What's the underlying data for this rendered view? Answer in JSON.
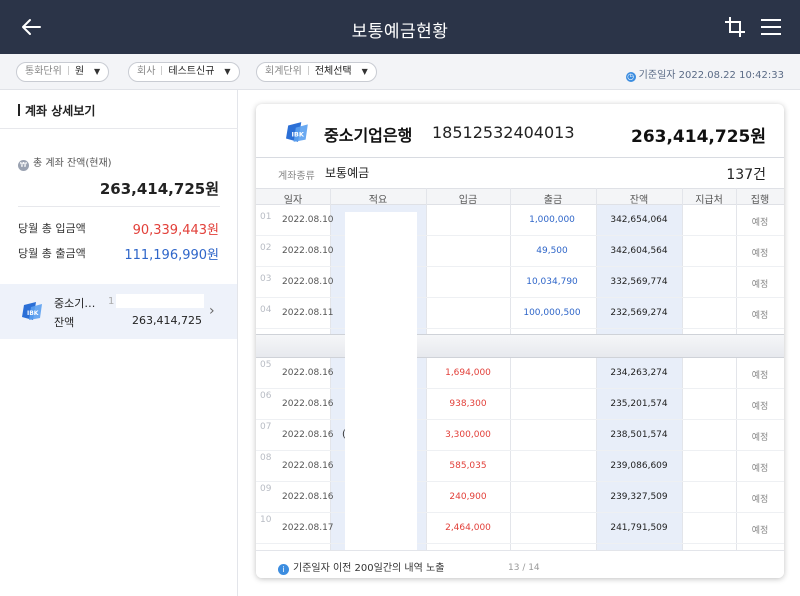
{
  "header": {
    "title": "보통예금현황",
    "back_icon": "back-arrow-icon",
    "crop_icon": "crop-icon",
    "menu_icon": "hamburger-menu-icon"
  },
  "filters": {
    "currency": {
      "label": "통화단위",
      "value": "원"
    },
    "company": {
      "label": "회사",
      "value": "테스트신규"
    },
    "account_unit": {
      "label": "회계단위",
      "value": "전체선택"
    },
    "base_date": "기준일자 2022.08.22 10:42:33"
  },
  "left": {
    "section_title": "계좌 상세보기",
    "total_label": "총 계좌 잔액(현재)",
    "total_amount": "263,414,725원",
    "deposit_label": "당월 총 입금액",
    "deposit_value": "90,339,443원",
    "withdraw_label": "당월 총 출금액",
    "withdraw_value": "111,196,990원",
    "account": {
      "name": "중소기…",
      "number_prefix": "1",
      "balance_label": "잔액",
      "balance": "263,414,725"
    }
  },
  "card": {
    "bank": "중소기업은행",
    "account_number": "18512532404013",
    "balance": "263,414,725원",
    "type_label": "계좌종류",
    "type_value": "보통예금",
    "count": "137건",
    "columns": [
      "일자",
      "적요",
      "입금",
      "출금",
      "잔액",
      "지급처",
      "집행"
    ],
    "rows": [
      {
        "idx": "01",
        "date": "2022.08.10",
        "summary": "",
        "in": "",
        "out": "1,000,000",
        "bal": "342,654,064",
        "payee": "",
        "exec": "예정"
      },
      {
        "idx": "02",
        "date": "2022.08.10",
        "summary": "",
        "in": "",
        "out": "49,500",
        "bal": "342,604,564",
        "payee": "",
        "exec": "예정"
      },
      {
        "idx": "03",
        "date": "2022.08.10",
        "summary": "",
        "in": "",
        "out": "10,034,790",
        "bal": "332,569,774",
        "payee": "",
        "exec": "예정"
      },
      {
        "idx": "04",
        "date": "2022.08.11",
        "summary": "",
        "in": "",
        "out": "100,000,500",
        "bal": "232,569,274",
        "payee": "",
        "exec": "예정"
      },
      {
        "idx": "05",
        "date": "2022.08.16",
        "summary": "",
        "in": "1,694,000",
        "out": "",
        "bal": "234,263,274",
        "payee": "",
        "exec": "예정"
      },
      {
        "idx": "06",
        "date": "2022.08.16",
        "summary": "",
        "in": "938,300",
        "out": "",
        "bal": "235,201,574",
        "payee": "",
        "exec": "예정"
      },
      {
        "idx": "07",
        "date": "2022.08.16",
        "summary": "(",
        "in": "3,300,000",
        "out": "",
        "bal": "238,501,574",
        "payee": "",
        "exec": "예정"
      },
      {
        "idx": "08",
        "date": "2022.08.16",
        "summary": "",
        "in": "585,035",
        "out": "",
        "bal": "239,086,609",
        "payee": "",
        "exec": "예정"
      },
      {
        "idx": "09",
        "date": "2022.08.16",
        "summary": "",
        "in": "240,900",
        "out": "",
        "bal": "239,327,509",
        "payee": "",
        "exec": "예정"
      },
      {
        "idx": "10",
        "date": "2022.08.17",
        "summary": "",
        "in": "2,464,000",
        "out": "",
        "bal": "241,791,509",
        "payee": "",
        "exec": "예정"
      }
    ],
    "footer_note": "기준일자 이전 200일간의 내역 노출",
    "page": "13 / 14"
  }
}
